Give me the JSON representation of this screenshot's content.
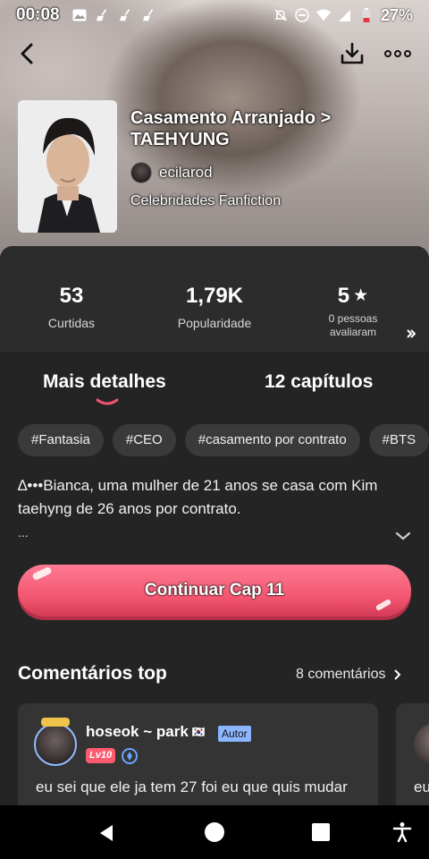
{
  "status_bar": {
    "time": "00:08",
    "battery": "27%",
    "icons": [
      "image-icon",
      "broom-icon",
      "broom-icon",
      "broom-icon",
      "mute-icon",
      "dnd-icon",
      "wifi-icon",
      "signal-icon",
      "battery-icon"
    ]
  },
  "header": {
    "icons": {
      "back": "back-arrow-icon",
      "download": "download-icon",
      "more": "more-icon"
    }
  },
  "book": {
    "title": "Casamento Arranjado > TAEHYUNG",
    "author": "ecilarod",
    "category": "Celebridades Fanfiction"
  },
  "stats": {
    "likes": {
      "value": "53",
      "label": "Curtidas"
    },
    "popularity": {
      "value": "1,79K",
      "label": "Popularidade"
    },
    "rating": {
      "value": "5",
      "label_line1": "0 pessoas",
      "label_line2": "avaliaram"
    }
  },
  "tabs": {
    "details": "Mais detalhes",
    "chapters": "12 capítulos"
  },
  "tags": [
    "#Fantasia",
    "#CEO",
    "#casamento por contrato",
    "#BTS"
  ],
  "synopsis": {
    "line1": "∆•••Bianca, uma mulher de 21 anos se casa com Kim",
    "line2": "taehyng de 26 anos por contrato.",
    "ellipsis": "..."
  },
  "continue_button": "Continuar Cap 11",
  "comments": {
    "heading": "Comentários top",
    "count_link": "8 comentários",
    "items": [
      {
        "user": "hoseok ~ park",
        "flag": "🇰🇷",
        "author_badge": "Autor",
        "level": "Lv10",
        "text": "eu sei que ele ja tem 27 foi eu que quis mudar"
      },
      {
        "text": "eu"
      }
    ]
  },
  "colors": {
    "accent": "#f2556f",
    "panel": "#242424",
    "tag_bg": "#3a3a3a"
  }
}
